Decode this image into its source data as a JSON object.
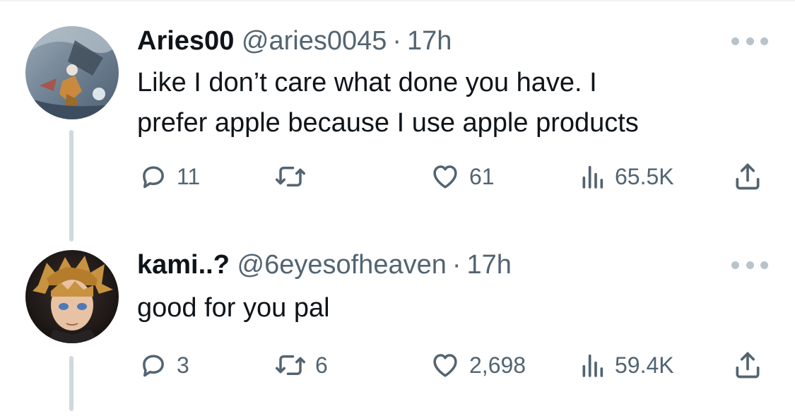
{
  "tweets": [
    {
      "display_name": "Aries00",
      "handle": "@aries0045",
      "separator": "·",
      "time": "17h",
      "text_lines": [
        "Like I don’t care what done you have. I",
        "prefer apple because I use apple products"
      ],
      "replies": "11",
      "retweets": "",
      "likes": "61",
      "views": "65.5K"
    },
    {
      "display_name": "kami..?",
      "handle": "@6eyesofheaven",
      "separator": "·",
      "time": "17h",
      "text_lines": [
        "good for you pal"
      ],
      "replies": "3",
      "retweets": "6",
      "likes": "2,698",
      "views": "59.4K"
    }
  ],
  "icons": {
    "reply": "reply-icon",
    "retweet": "retweet-icon",
    "like": "heart-icon",
    "views": "views-icon",
    "share": "share-icon",
    "more": "more-icon"
  },
  "colors": {
    "text_primary": "#0f1419",
    "text_secondary": "#536471",
    "thread_line": "#cfd9de"
  }
}
